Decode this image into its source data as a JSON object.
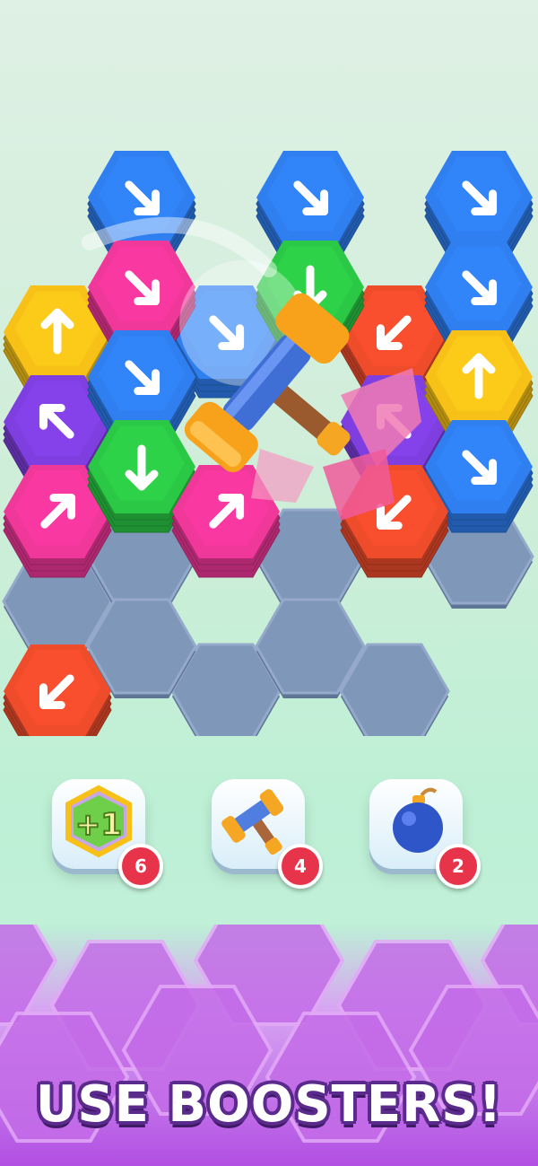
{
  "board": {
    "colors": {
      "yellow": "#f7c118",
      "blue": "#2f7ff0",
      "red": "#ef4c2c",
      "pink": "#f0379a",
      "purple": "#7f3fe0",
      "green": "#2bc845",
      "empty": "#7f97b8"
    },
    "tiles": [
      {
        "color": "blue",
        "arrow": "down-right",
        "col": 1,
        "row": 0
      },
      {
        "color": "blue",
        "arrow": "down-right",
        "col": 3,
        "row": 0
      },
      {
        "color": "blue",
        "arrow": "down-right",
        "col": 5,
        "row": 0
      },
      {
        "color": "yellow",
        "arrow": "up",
        "col": 0,
        "row": 1
      },
      {
        "color": "blue",
        "arrow": "down-right",
        "col": 2,
        "row": 1
      },
      {
        "color": "red",
        "arrow": "down-left",
        "col": 4,
        "row": 1
      },
      {
        "color": "pink",
        "arrow": "down-right",
        "col": 1,
        "row": 1
      },
      {
        "color": "green",
        "arrow": "down",
        "col": 3,
        "row": 1
      },
      {
        "color": "blue",
        "arrow": "down-right",
        "col": 5,
        "row": 1
      },
      {
        "color": "purple",
        "arrow": "up-left",
        "col": 0,
        "row": 2
      },
      {
        "color": "blue",
        "arrow": "down-right",
        "col": 1,
        "row": 2
      },
      {
        "color": "purple",
        "arrow": "up-left",
        "col": 4,
        "row": 2
      },
      {
        "color": "yellow",
        "arrow": "up",
        "col": 5,
        "row": 2
      },
      {
        "color": "pink",
        "arrow": "up-right",
        "col": 0,
        "row": 3
      },
      {
        "color": "blue",
        "arrow": "down-right",
        "col": 5,
        "row": 3
      },
      {
        "color": "green",
        "arrow": "down",
        "col": 1,
        "row": 3
      },
      {
        "color": "pink",
        "arrow": "up-right",
        "col": 2,
        "row": 3
      },
      {
        "color": "red",
        "arrow": "down-left",
        "col": 4,
        "row": 3
      },
      {
        "color": "red",
        "arrow": "down-left",
        "col": 0,
        "row": 5
      }
    ]
  },
  "boosters": [
    {
      "name": "plus-one",
      "label": "+1",
      "count": "6"
    },
    {
      "name": "hammer",
      "count": "4"
    },
    {
      "name": "bomb",
      "count": "2"
    }
  ],
  "caption": "USE BOOSTERS!"
}
